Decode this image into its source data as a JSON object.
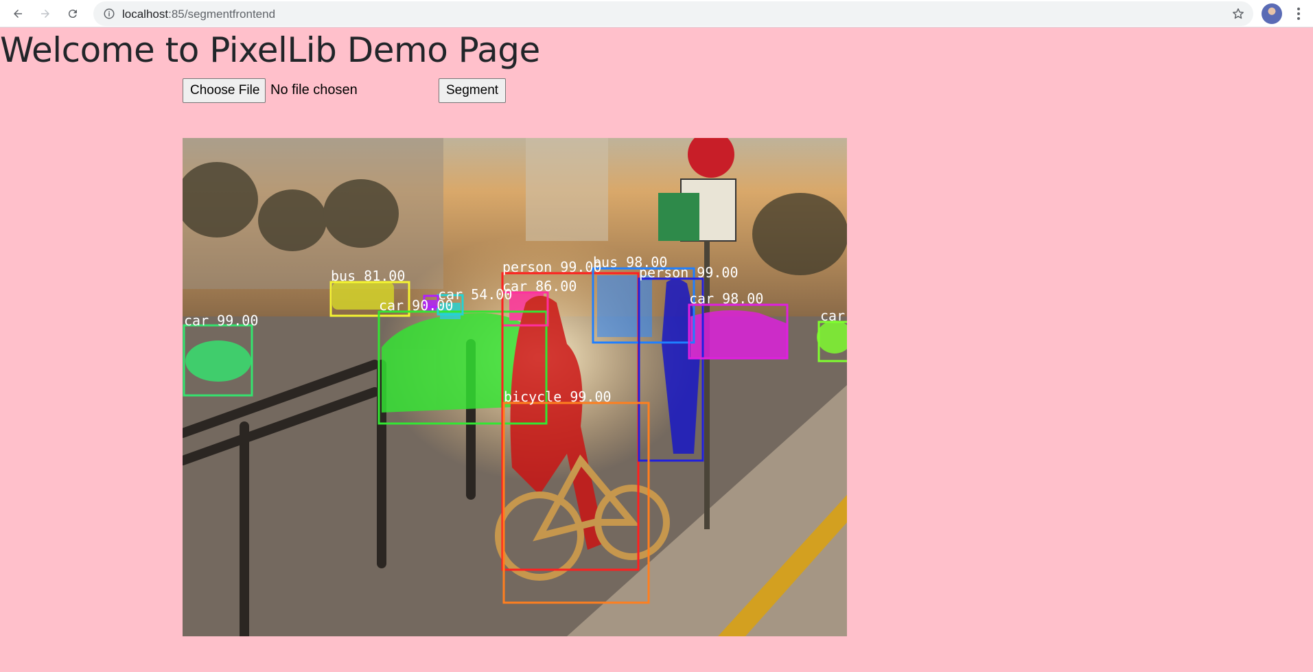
{
  "browser": {
    "url_host": "localhost",
    "url_path": ":85/segmentfrontend"
  },
  "page": {
    "title": "Welcome to PixelLib Demo Page"
  },
  "upload": {
    "choose_label": "Choose File",
    "status": "No file chosen",
    "segment_label": "Segment"
  },
  "detections": [
    {
      "label": "bus 81.00",
      "color": "#f5f532"
    },
    {
      "label": "car 99.00",
      "color": "#35e36f"
    },
    {
      "label": "car 90.00",
      "color": "#33e633"
    },
    {
      "label": "car 54.00",
      "color": "#22d4d4"
    },
    {
      "label": "car 86.00",
      "color": "#ff2f9f"
    },
    {
      "label": "person 99.00",
      "color": "#ff1f1f"
    },
    {
      "label": "bus 98.00",
      "color": "#1f7fff"
    },
    {
      "label": "person 99.00",
      "color": "#1f1fdf"
    },
    {
      "label": "car 98.00",
      "color": "#e01fe0"
    },
    {
      "label": "car",
      "color": "#7fff2f"
    },
    {
      "label": "bicycle 99.00",
      "color": "#ff7f1f"
    }
  ]
}
